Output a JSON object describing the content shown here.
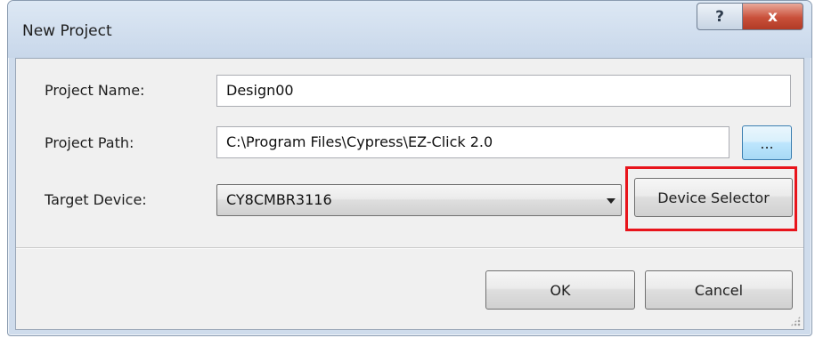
{
  "window": {
    "title": "New Project",
    "help_glyph": "?",
    "close_glyph": "x"
  },
  "form": {
    "project_name": {
      "label": "Project Name:",
      "value": "Design00"
    },
    "project_path": {
      "label": "Project Path:",
      "value": "C:\\Program Files\\Cypress\\EZ-Click 2.0",
      "browse_label": "..."
    },
    "target_device": {
      "label": "Target Device:",
      "selected": "CY8CMBR3116",
      "selector_label": "Device Selector"
    }
  },
  "footer": {
    "ok_label": "OK",
    "cancel_label": "Cancel"
  },
  "colors": {
    "highlight": "#e8141b",
    "title_bar": "#cfdcec",
    "close_button": "#c9503a"
  },
  "icons": [
    "help-icon",
    "close-icon",
    "dropdown-arrow-icon",
    "resize-grip-icon"
  ]
}
